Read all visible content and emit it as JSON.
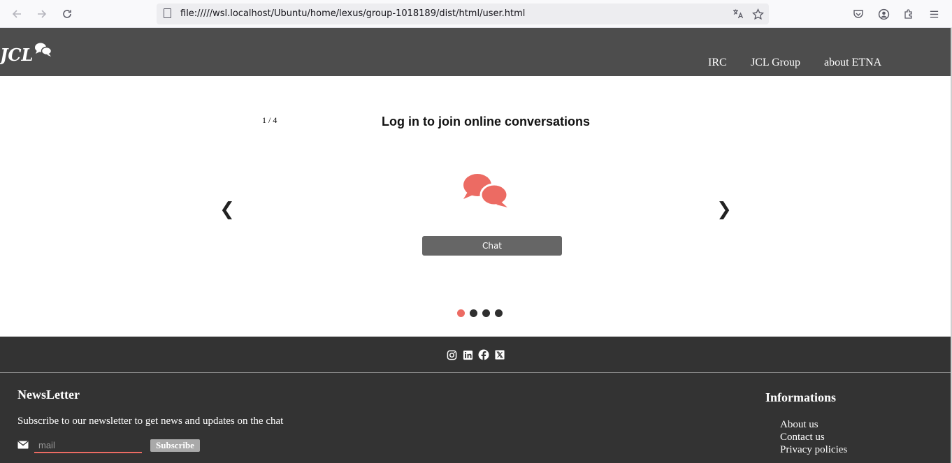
{
  "browser": {
    "url": "file://///wsl.localhost/Ubuntu/home/lexus/group-1018189/dist/html/user.html",
    "icons": [
      "back-icon",
      "forward-icon",
      "reload-icon",
      "page-icon",
      "translate-icon",
      "bookmark-star-icon",
      "pocket-icon",
      "account-icon",
      "extensions-icon",
      "menu-icon"
    ]
  },
  "header": {
    "logo_text": "JCL",
    "nav": [
      "IRC",
      "JCL Group",
      "about ETNA"
    ]
  },
  "carousel": {
    "counter": "1 / 4",
    "title": "Log in to join online conversations",
    "prev_label": "❮",
    "next_label": "❯",
    "button_label": "Chat",
    "total_slides": 4,
    "active_slide": 1,
    "icon": "chat-bubbles-icon"
  },
  "footer": {
    "social": [
      "instagram-icon",
      "linkedin-icon",
      "facebook-icon",
      "x-icon"
    ],
    "newsletter": {
      "title": "NewsLetter",
      "description": "Subscribe to our newsletter to get news and updates on the chat",
      "placeholder": "mail",
      "subscribe_label": "Subscribe"
    },
    "info": {
      "title": "Informations",
      "links": [
        "About us",
        "Contact us",
        "Privacy policies"
      ]
    }
  },
  "colors": {
    "header_bg": "#4d4d4d",
    "footer_bg": "#333333",
    "accent": "#ec6b63",
    "button_bg": "#666666"
  }
}
